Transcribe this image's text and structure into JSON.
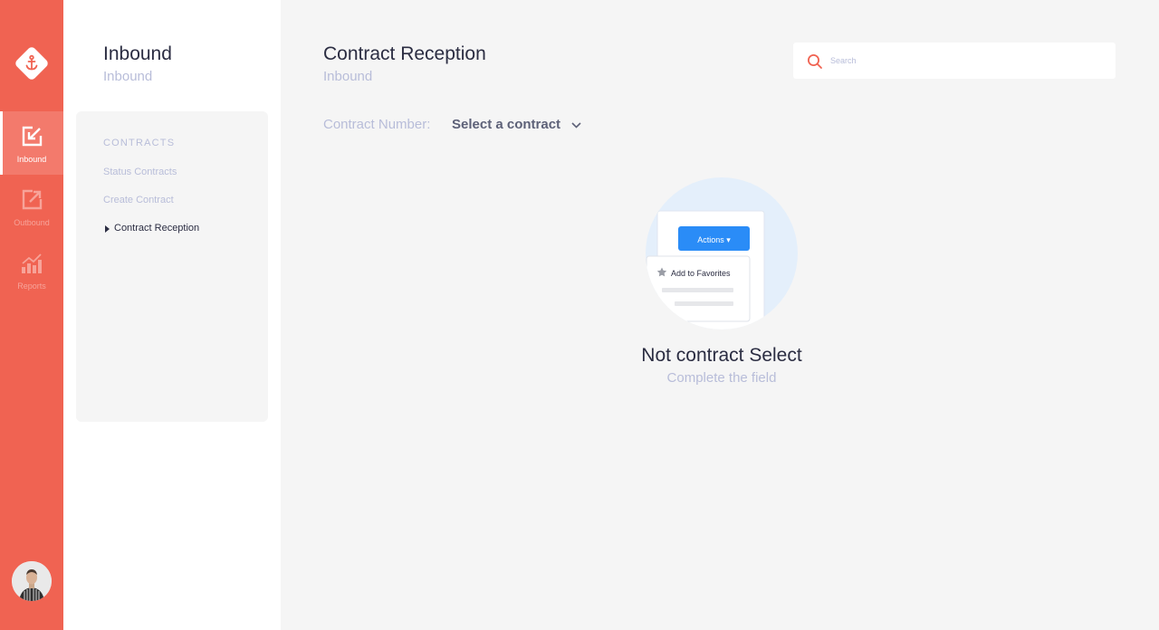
{
  "rail": {
    "logo_icon": "anchor-icon",
    "items": [
      {
        "label": "Inbound",
        "icon": "inbound-icon",
        "active": true
      },
      {
        "label": "Outbound",
        "icon": "outbound-icon",
        "active": false
      },
      {
        "label": "Reports",
        "icon": "reports-icon",
        "active": false
      }
    ],
    "avatar_icon": "user-avatar"
  },
  "sidebar": {
    "title": "Inbound",
    "subtitle": "Inbound",
    "section_heading": "CONTRACTS",
    "links": [
      {
        "label": "Status Contracts",
        "active": false
      },
      {
        "label": "Create Contract",
        "active": false
      },
      {
        "label": "Contract Reception",
        "active": true
      }
    ]
  },
  "header": {
    "title": "Contract Reception",
    "subtitle": "Inbound"
  },
  "search": {
    "placeholder": "Search",
    "icon": "search-icon"
  },
  "contract": {
    "label": "Contract Number:",
    "select_value": "Select a contract",
    "icon": "chevron-down-icon"
  },
  "empty_state": {
    "illustration": {
      "button_label": "Actions ▾",
      "menu_item": "Add to Favorites"
    },
    "title": "Not contract Select",
    "subtitle": "Complete the field"
  },
  "colors": {
    "accent": "#f06352",
    "blue": "#2a8cf7",
    "text": "#2b2d42",
    "muted": "#b8bdd9",
    "bg": "#f5f5f5"
  }
}
